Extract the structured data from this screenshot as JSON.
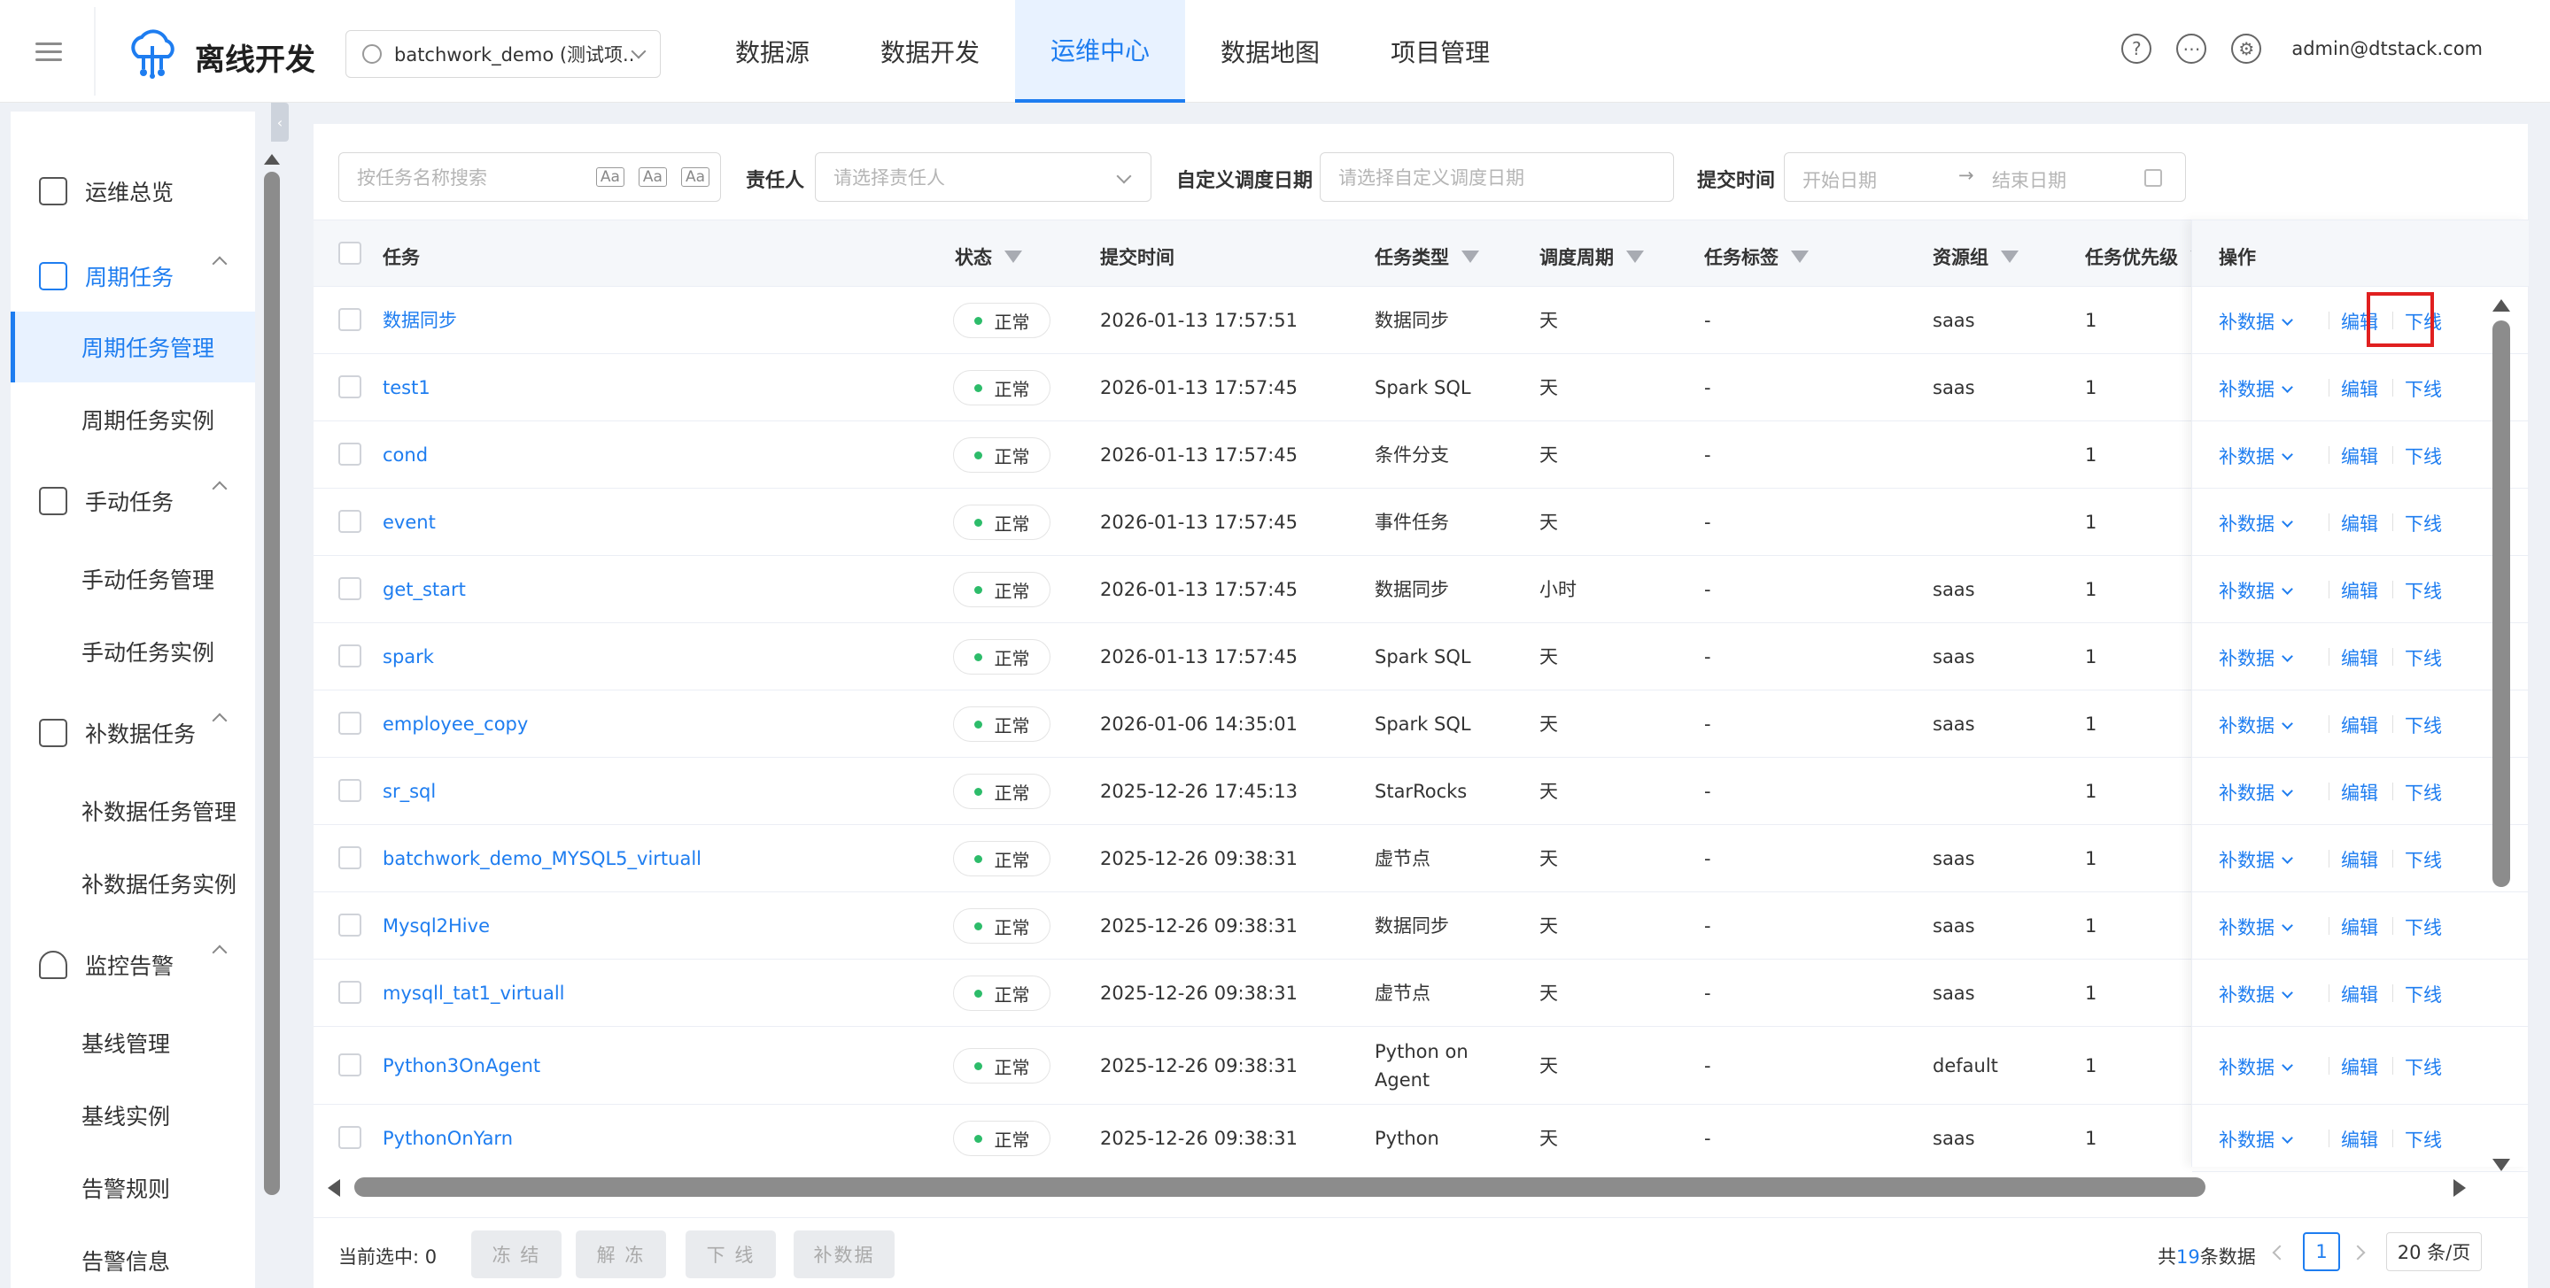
{
  "header": {
    "brand": "离线开发",
    "project": "batchwork_demo (测试项...",
    "nav": [
      "数据源",
      "数据开发",
      "运维中心",
      "数据地图",
      "项目管理"
    ],
    "active_nav_index": 2,
    "user": "admin@dtstack.com",
    "icons": [
      "help-icon",
      "message-icon",
      "settings-icon"
    ]
  },
  "sidebar": {
    "overview": "运维总览",
    "groups": [
      {
        "label": "周期任务",
        "items": [
          "周期任务管理",
          "周期任务实例"
        ]
      },
      {
        "label": "手动任务",
        "items": [
          "手动任务管理",
          "手动任务实例"
        ]
      },
      {
        "label": "补数据任务",
        "items": [
          "补数据任务管理",
          "补数据任务实例"
        ]
      },
      {
        "label": "监控告警",
        "items": [
          "基线管理",
          "基线实例",
          "告警规则",
          "告警信息"
        ]
      }
    ],
    "active_item": "周期任务管理"
  },
  "filters": {
    "search_placeholder": "按任务名称搜索",
    "owner_label": "责任人",
    "owner_placeholder": "请选择责任人",
    "custom_date_label": "自定义调度日期",
    "custom_date_placeholder": "请选择自定义调度日期",
    "submit_time_label": "提交时间",
    "start_placeholder": "开始日期",
    "end_placeholder": "结束日期"
  },
  "table": {
    "columns": [
      "任务",
      "状态",
      "提交时间",
      "任务类型",
      "调度周期",
      "任务标签",
      "资源组",
      "任务优先级",
      "操作"
    ],
    "status_color": "#2dbc6a",
    "rows": [
      {
        "name": "数据同步",
        "status": "正常",
        "time": "2026-01-13 17:57:51",
        "type": "数据同步",
        "cycle": "天",
        "tag": "-",
        "group": "saas",
        "priority": "1"
      },
      {
        "name": "test1",
        "status": "正常",
        "time": "2026-01-13 17:57:45",
        "type": "Spark SQL",
        "cycle": "天",
        "tag": "-",
        "group": "saas",
        "priority": "1"
      },
      {
        "name": "cond",
        "status": "正常",
        "time": "2026-01-13 17:57:45",
        "type": "条件分支",
        "cycle": "天",
        "tag": "-",
        "group": "",
        "priority": "1"
      },
      {
        "name": "event",
        "status": "正常",
        "time": "2026-01-13 17:57:45",
        "type": "事件任务",
        "cycle": "天",
        "tag": "-",
        "group": "",
        "priority": "1"
      },
      {
        "name": "get_start",
        "status": "正常",
        "time": "2026-01-13 17:57:45",
        "type": "数据同步",
        "cycle": "小时",
        "tag": "-",
        "group": "saas",
        "priority": "1"
      },
      {
        "name": "spark",
        "status": "正常",
        "time": "2026-01-13 17:57:45",
        "type": "Spark SQL",
        "cycle": "天",
        "tag": "-",
        "group": "saas",
        "priority": "1"
      },
      {
        "name": "employee_copy",
        "status": "正常",
        "time": "2026-01-06 14:35:01",
        "type": "Spark SQL",
        "cycle": "天",
        "tag": "-",
        "group": "saas",
        "priority": "1"
      },
      {
        "name": "sr_sql",
        "status": "正常",
        "time": "2025-12-26 17:45:13",
        "type": "StarRocks",
        "cycle": "天",
        "tag": "-",
        "group": "",
        "priority": "1"
      },
      {
        "name": "batchwork_demo_MYSQL5_virtuall",
        "status": "正常",
        "time": "2025-12-26 09:38:31",
        "type": "虚节点",
        "cycle": "天",
        "tag": "-",
        "group": "saas",
        "priority": "1"
      },
      {
        "name": "Mysql2Hive",
        "status": "正常",
        "time": "2025-12-26 09:38:31",
        "type": "数据同步",
        "cycle": "天",
        "tag": "-",
        "group": "saas",
        "priority": "1"
      },
      {
        "name": "mysqll_tat1_virtuall",
        "status": "正常",
        "time": "2025-12-26 09:38:31",
        "type": "虚节点",
        "cycle": "天",
        "tag": "-",
        "group": "saas",
        "priority": "1"
      },
      {
        "name": "Python3OnAgent",
        "status": "正常",
        "time": "2025-12-26 09:38:31",
        "type": "Python on Agent",
        "cycle": "天",
        "tag": "-",
        "group": "default",
        "priority": "1"
      },
      {
        "name": "PythonOnYarn",
        "status": "正常",
        "time": "2025-12-26 09:38:31",
        "type": "Python",
        "cycle": "天",
        "tag": "-",
        "group": "saas",
        "priority": "1"
      }
    ],
    "actions": {
      "fill": "补数据",
      "edit": "编辑",
      "offline": "下线"
    }
  },
  "footer": {
    "selected_label": "当前选中:",
    "selected_count": "0",
    "buttons": [
      "冻 结",
      "解 冻",
      "下 线",
      "补数据"
    ],
    "total_prefix": "共",
    "total": "19",
    "total_suffix": "条数据",
    "current_page": "1",
    "page_size": "20 条/页"
  }
}
